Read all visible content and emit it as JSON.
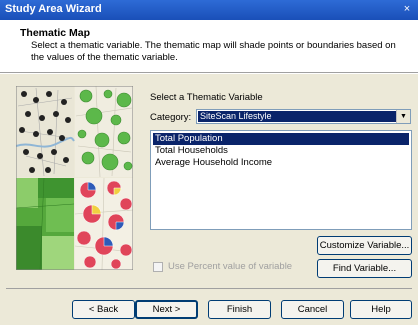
{
  "window": {
    "title": "Study Area Wizard",
    "close_glyph": "×"
  },
  "header": {
    "title": "Thematic Map",
    "description": "Select a thematic variable.  The thematic map will shade points or boundaries based on the values of the thematic variable."
  },
  "section_label": "Select a Thematic Variable",
  "category": {
    "label": "Category:",
    "value": "SiteScan Lifestyle"
  },
  "variables": {
    "items": [
      "Total Population",
      "Total Households",
      "Average Household Income"
    ],
    "selected_index": 0
  },
  "buttons": {
    "customize": "Customize Variable...",
    "find": "Find Variable...",
    "back": "< Back",
    "next": "Next >",
    "finish": "Finish",
    "cancel": "Cancel",
    "help": "Help"
  },
  "percent_checkbox": {
    "label": "Use Percent value of variable",
    "checked": false,
    "enabled": false
  },
  "colors": {
    "accent": "#0a246a",
    "titlebar": "#1a4fb8",
    "pie_red": "#e0455a",
    "pie_blue": "#2e5bb8",
    "map_green": "#4caa3c"
  }
}
